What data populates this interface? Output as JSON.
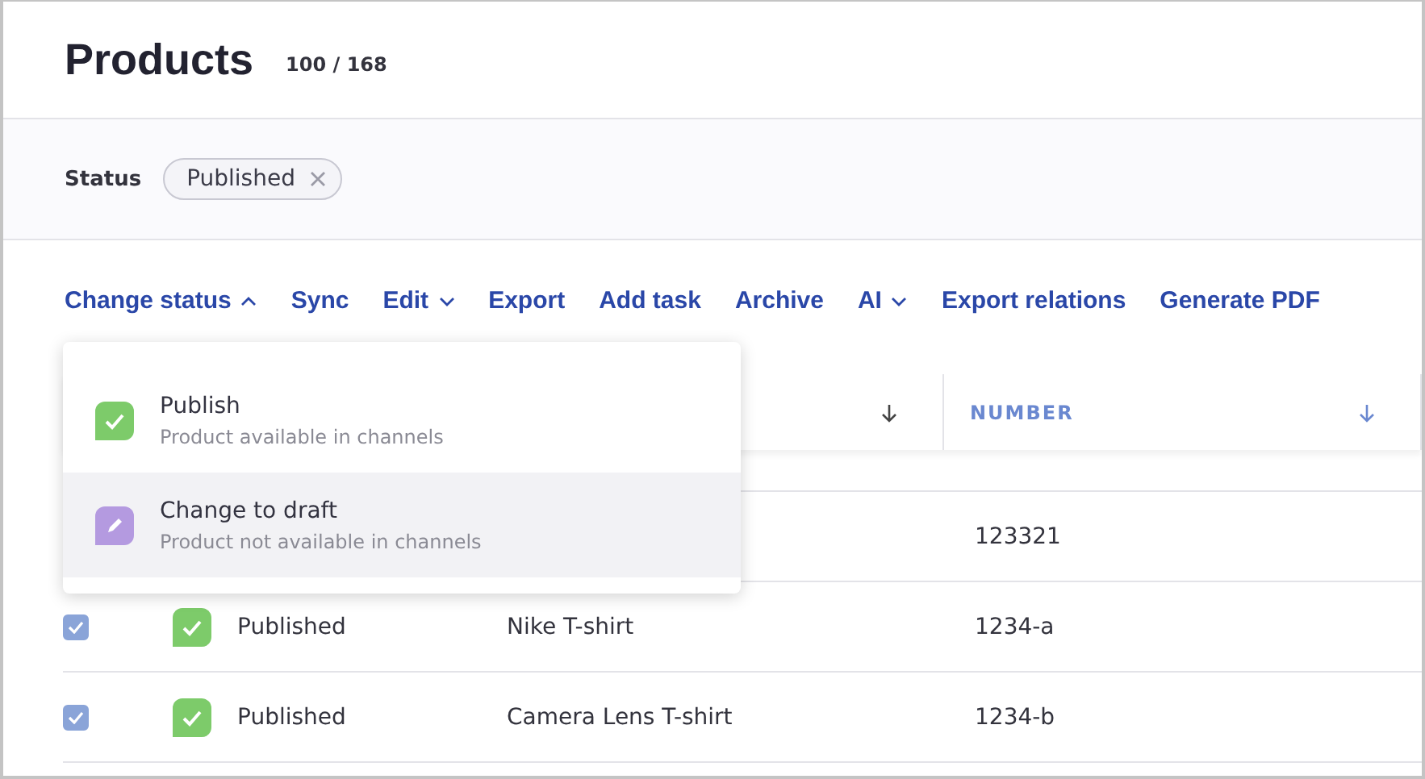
{
  "page": {
    "title": "Products",
    "count": "100 / 168"
  },
  "filters": [
    {
      "label": "Status",
      "chips": [
        {
          "label": "Published"
        }
      ]
    }
  ],
  "toolbar": [
    {
      "label": "Change status",
      "kind": "menu",
      "expanded": true
    },
    {
      "label": "Sync",
      "kind": "action"
    },
    {
      "label": "Edit",
      "kind": "menu",
      "expanded": false
    },
    {
      "label": "Export",
      "kind": "action"
    },
    {
      "label": "Add task",
      "kind": "action"
    },
    {
      "label": "Archive",
      "kind": "action"
    },
    {
      "label": "AI",
      "kind": "menu",
      "expanded": false
    },
    {
      "label": "Export relations",
      "kind": "action"
    },
    {
      "label": "Generate PDF",
      "kind": "action"
    }
  ],
  "status_menu": [
    {
      "kind": "published",
      "title": "Publish",
      "description": "Product available in channels",
      "selected": false
    },
    {
      "kind": "draft",
      "title": "Change to draft",
      "description": "Product not available in channels",
      "selected": true
    }
  ],
  "table": {
    "columns": [
      {
        "sorted_descending": true
      },
      {
        "label": "NUMBER",
        "sorted_descending": true
      }
    ],
    "rows": [
      {},
      {
        "number": "123321"
      },
      {
        "checked": true,
        "status": {
          "kind": "published",
          "label": "Published"
        },
        "name": "Nike T-shirt",
        "number": "1234-a"
      },
      {
        "checked": true,
        "status": {
          "kind": "published",
          "label": "Published"
        },
        "name": "Camera Lens T-shirt",
        "number": "1234-b"
      }
    ]
  }
}
